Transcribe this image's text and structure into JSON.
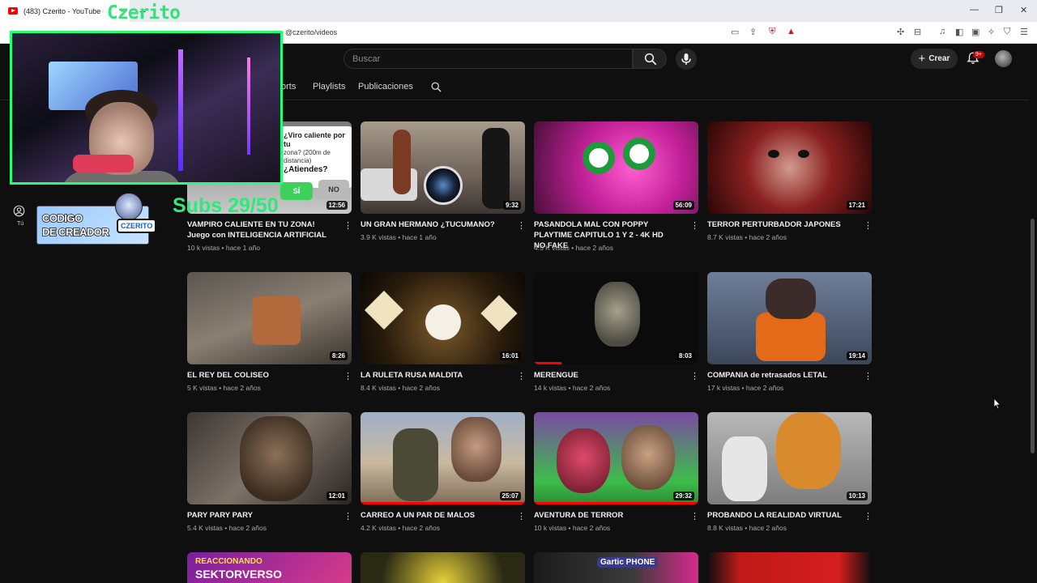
{
  "browser": {
    "tab_title": "(483) Czerito - YouTube",
    "tab_close": "×",
    "new_tab": "+",
    "url": "@czerito/videos",
    "window_controls": [
      "—",
      "❐",
      "✕"
    ]
  },
  "header": {
    "search_placeholder": "Buscar",
    "create_label": "Crear",
    "create_plus": "+",
    "notification_badge": "9+"
  },
  "channel_tabs": [
    "orts",
    "Playlists",
    "Publicaciones"
  ],
  "sidebar": {
    "you_label": "Tú"
  },
  "overlay": {
    "cam_title": "Czerito",
    "subs_text": "Subs 29/50",
    "creator_line1": "CODIGO",
    "creator_line2": "DE CREADOR",
    "creator_tag": "CZERITO"
  },
  "videos": [
    {
      "title": "VAMPIRO CALIENTE EN TU ZONA! Juego con INTELIGENCIA ARTIFICIAL",
      "meta": "10 k vistas • hace 1 año",
      "duration": "12:56"
    },
    {
      "title": "UN GRAN HERMANO ¿TUCUMANO?",
      "meta": "3.9 K vistas • hace 1 año",
      "duration": "9:32"
    },
    {
      "title": "PASANDOLA MAL CON POPPY PLAYTIME CAPITULO 1 Y 2 - 4K HD NO FAKE",
      "meta": "4.5 K vistas • hace 2 años",
      "duration": "56:09"
    },
    {
      "title": "TERROR PERTURBADOR JAPONES",
      "meta": "8.7 K vistas • hace 2 años",
      "duration": "17:21"
    },
    {
      "title": "EL REY DEL COLISEO",
      "meta": "5 K vistas • hace 2 años",
      "duration": "8:26"
    },
    {
      "title": "LA RULETA RUSA MALDITA",
      "meta": "8.4 K vistas • hace 2 años",
      "duration": "16:01"
    },
    {
      "title": "MERENGUE",
      "meta": "14 k vistas • hace 2 años",
      "duration": "8:03"
    },
    {
      "title": "COMPANIA de retrasados LETAL",
      "meta": "17 k vistas • hace 2 años",
      "duration": "19:14"
    },
    {
      "title": "PARY PARY PARY",
      "meta": "5.4 K vistas • hace 2 años",
      "duration": "12:01"
    },
    {
      "title": "CARREO A UN PAR DE MALOS",
      "meta": "4.2 K vistas • hace 2 años",
      "duration": "25:07"
    },
    {
      "title": "AVENTURA DE TERROR",
      "meta": "10 k vistas • hace 2 años",
      "duration": "29:32"
    },
    {
      "title": "PROBANDO LA REALIDAD VIRTUAL",
      "meta": "8.8 K vistas • hace 2 años",
      "duration": "10:13"
    }
  ],
  "thumb_texts": {
    "vampiro_q1": "¿Viro caliente por tu",
    "vampiro_q2": "zona? (200m de distancia)",
    "vampiro_q3": "¿Atiendes?",
    "vampiro_si": "SÍ",
    "vampiro_no": "NO",
    "row4_a": "REACCIONANDO",
    "row4_b": "SEKTORVERSO",
    "row4_c": "Gartic PHONE"
  },
  "colors": {
    "accent_green": "#22ff77",
    "youtube_red": "#ff0000",
    "background": "#0f0f0f"
  }
}
